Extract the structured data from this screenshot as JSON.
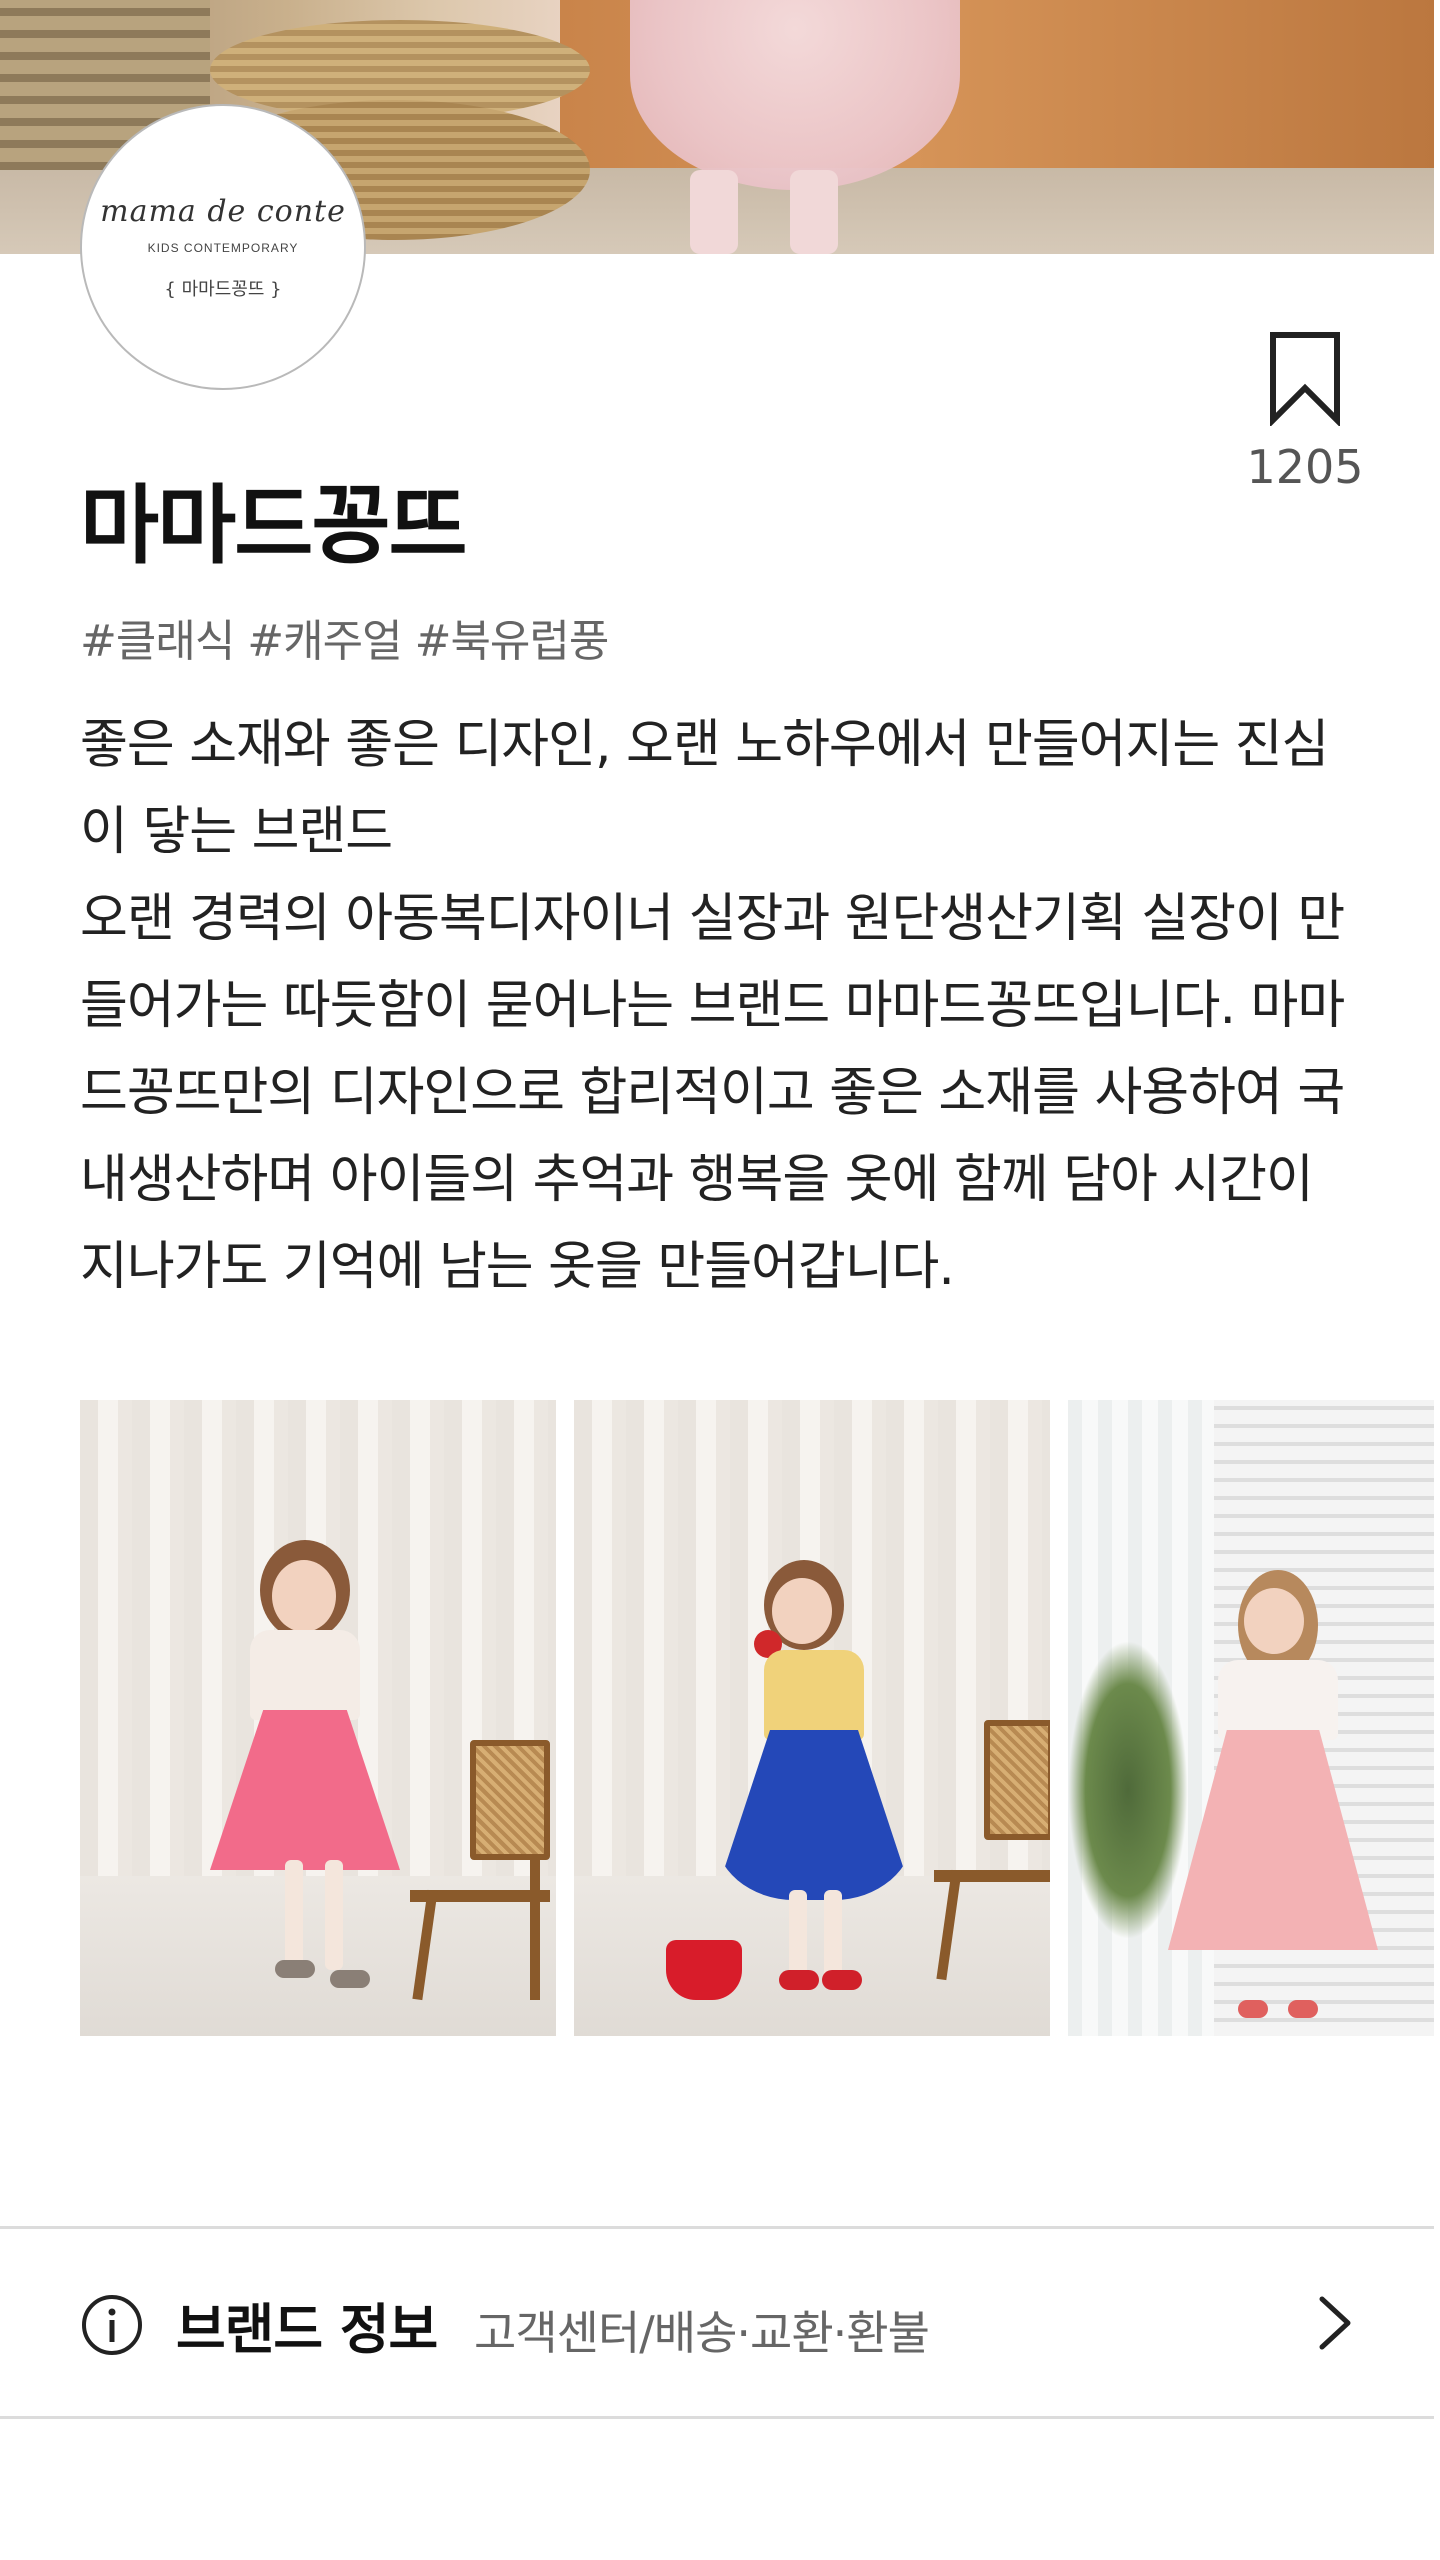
{
  "brand": {
    "name": "마마드꽁뜨",
    "tags": "#클래식 #캐주얼 #북유럽풍",
    "bookmark_count": "1205",
    "logo": {
      "script": "mama de conte",
      "subtitle": "KIDS CONTEMPORARY",
      "korean": "{ 마마드꽁뜨 }"
    },
    "description": [
      "좋은 소재와 좋은 디자인, 오랜 노하우에서 만들어지는 진심이 닿는 브랜드",
      "오랜 경력의 아동복디자이너 실장과 원단생산기획 실장이 만들어가는 따듯함이 묻어나는 브랜드 마마드꽁뜨입니다. 마마드꽁뜨만의 디자인으로 합리적이고 좋은 소재를 사용하여 국내생산하며 아이들의 추억과 행복을 옷에 함께 담아 시간이 지나가도 기억에 남는 옷을 만들어갑니다."
    ]
  },
  "info_row": {
    "title": "브랜드 정보",
    "subtitle": "고객센터/배송·교환·환불"
  },
  "icons": {
    "bookmark": "bookmark-icon",
    "info": "info-icon",
    "chevron": "chevron-right-icon"
  },
  "colors": {
    "text_primary": "#111111",
    "text_secondary": "#666666",
    "divider": "#dcdcdc"
  }
}
